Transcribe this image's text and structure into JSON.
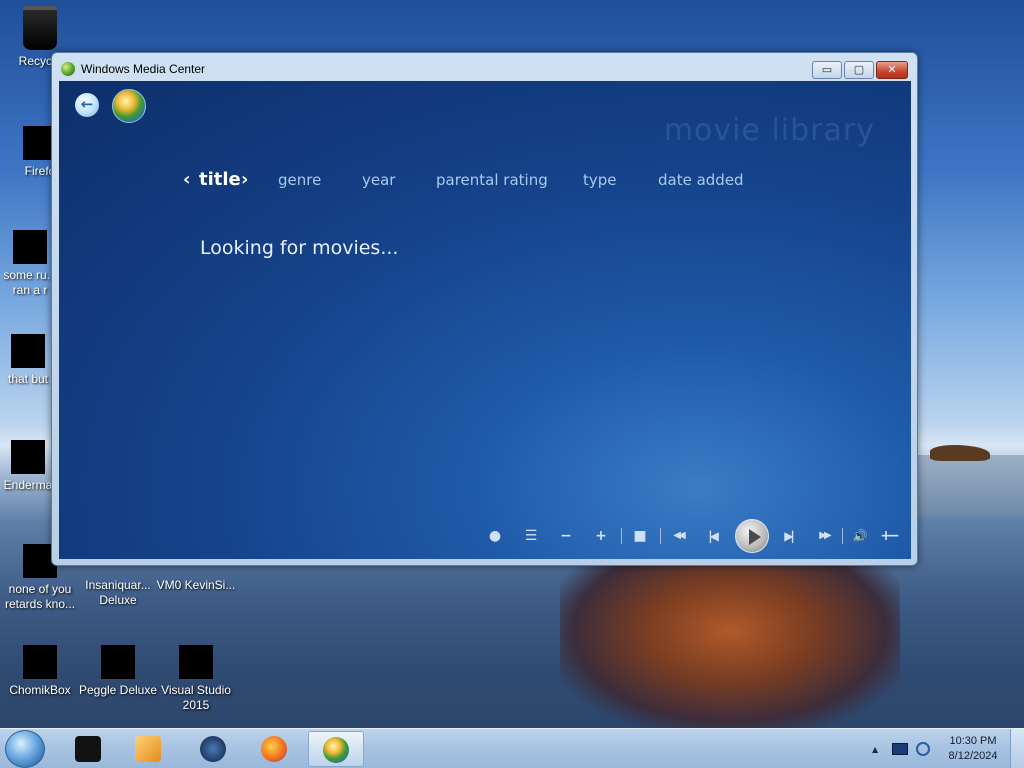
{
  "desktop": {
    "icons": [
      {
        "label": "Recycle"
      },
      {
        "label": "Firefo"
      },
      {
        "label": "some ru... ran a r"
      },
      {
        "label": "that but"
      },
      {
        "label": "Enderma"
      },
      {
        "label": "none of you retards kno..."
      },
      {
        "label": "Insaniquar... Deluxe"
      },
      {
        "label": "VM0 KevinSi..."
      },
      {
        "label": "ChomikBox"
      },
      {
        "label": "Peggle Deluxe"
      },
      {
        "label": "Visual Studio 2015"
      }
    ]
  },
  "window": {
    "title": "Windows Media Center",
    "caption_buttons": {
      "minimize": "▭",
      "maximize": "▢",
      "close": "✕"
    },
    "back_icon": "←",
    "library_title": "movie library",
    "tabs": [
      {
        "label": "title",
        "active": true
      },
      {
        "label": "genre",
        "active": false
      },
      {
        "label": "year",
        "active": false
      },
      {
        "label": "parental rating",
        "active": false
      },
      {
        "label": "type",
        "active": false
      },
      {
        "label": "date added",
        "active": false
      }
    ],
    "tab_chevron_left": "‹",
    "tab_chevron_right": "›",
    "status": "Looking for movies...",
    "controls": {
      "record": "●",
      "guide": "☰",
      "channel_down": "−",
      "channel_up": "+",
      "stop": "■",
      "rewind": "◀◀",
      "skip_back": "|◀",
      "skip_forward": "▶|",
      "fast_forward": "▶▶",
      "mute": "🔊",
      "volume_down": "−",
      "volume_up": "+"
    }
  },
  "taskbar": {
    "clock_time": "10:30 PM",
    "clock_date": "8/12/2024",
    "tray_arrow": "▲"
  },
  "colors": {
    "wmc_background": "#15428a",
    "tab_inactive": "#a9c9ee",
    "tab_active": "#ffffff",
    "close_button": "#c8432b"
  }
}
